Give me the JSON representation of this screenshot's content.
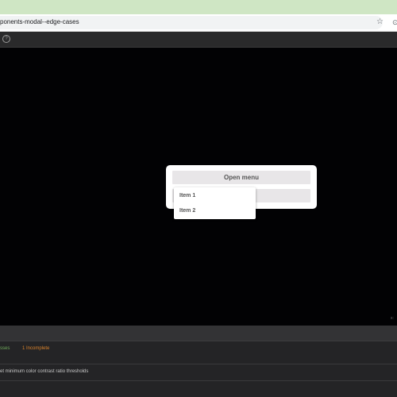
{
  "browser": {
    "url": "ponents-modal--edge-cases"
  },
  "icons": {
    "star": "star-icon",
    "extension": "extension-icon",
    "toolbar": "help-circle-icon"
  },
  "preview": {
    "corner_label": "x:"
  },
  "modal": {
    "open_menu_label": "Open menu",
    "second_button_label": ""
  },
  "menu": {
    "items": [
      {
        "label": "Item 1"
      },
      {
        "label": "Item 2"
      }
    ]
  },
  "addons_panel": {
    "tabs": {
      "passes_label": "sses",
      "incomplete_label": "1 Incomplete"
    },
    "row_text": "et minimum color contrast ratio thresholds"
  },
  "colors": {
    "passes": "#6fa95a",
    "incomplete": "#d9822b"
  }
}
